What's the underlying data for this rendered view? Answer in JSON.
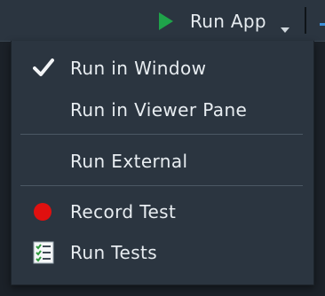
{
  "toolbar": {
    "run_app_label": "Run App",
    "play_icon": "play-icon",
    "caret_icon": "chevron-down-icon",
    "accent_green": "#1fa34a"
  },
  "menu": {
    "items": [
      {
        "label": "Run in Window",
        "icon": "checkmark-icon",
        "checked": true
      },
      {
        "label": "Run in Viewer Pane",
        "icon": "",
        "checked": false
      },
      {
        "label": "Run External",
        "icon": "",
        "checked": false
      },
      {
        "label": "Record Test",
        "icon": "record-dot-icon",
        "checked": false,
        "icon_color": "#e0100f"
      },
      {
        "label": "Run Tests",
        "icon": "checklist-icon",
        "checked": false
      }
    ]
  }
}
